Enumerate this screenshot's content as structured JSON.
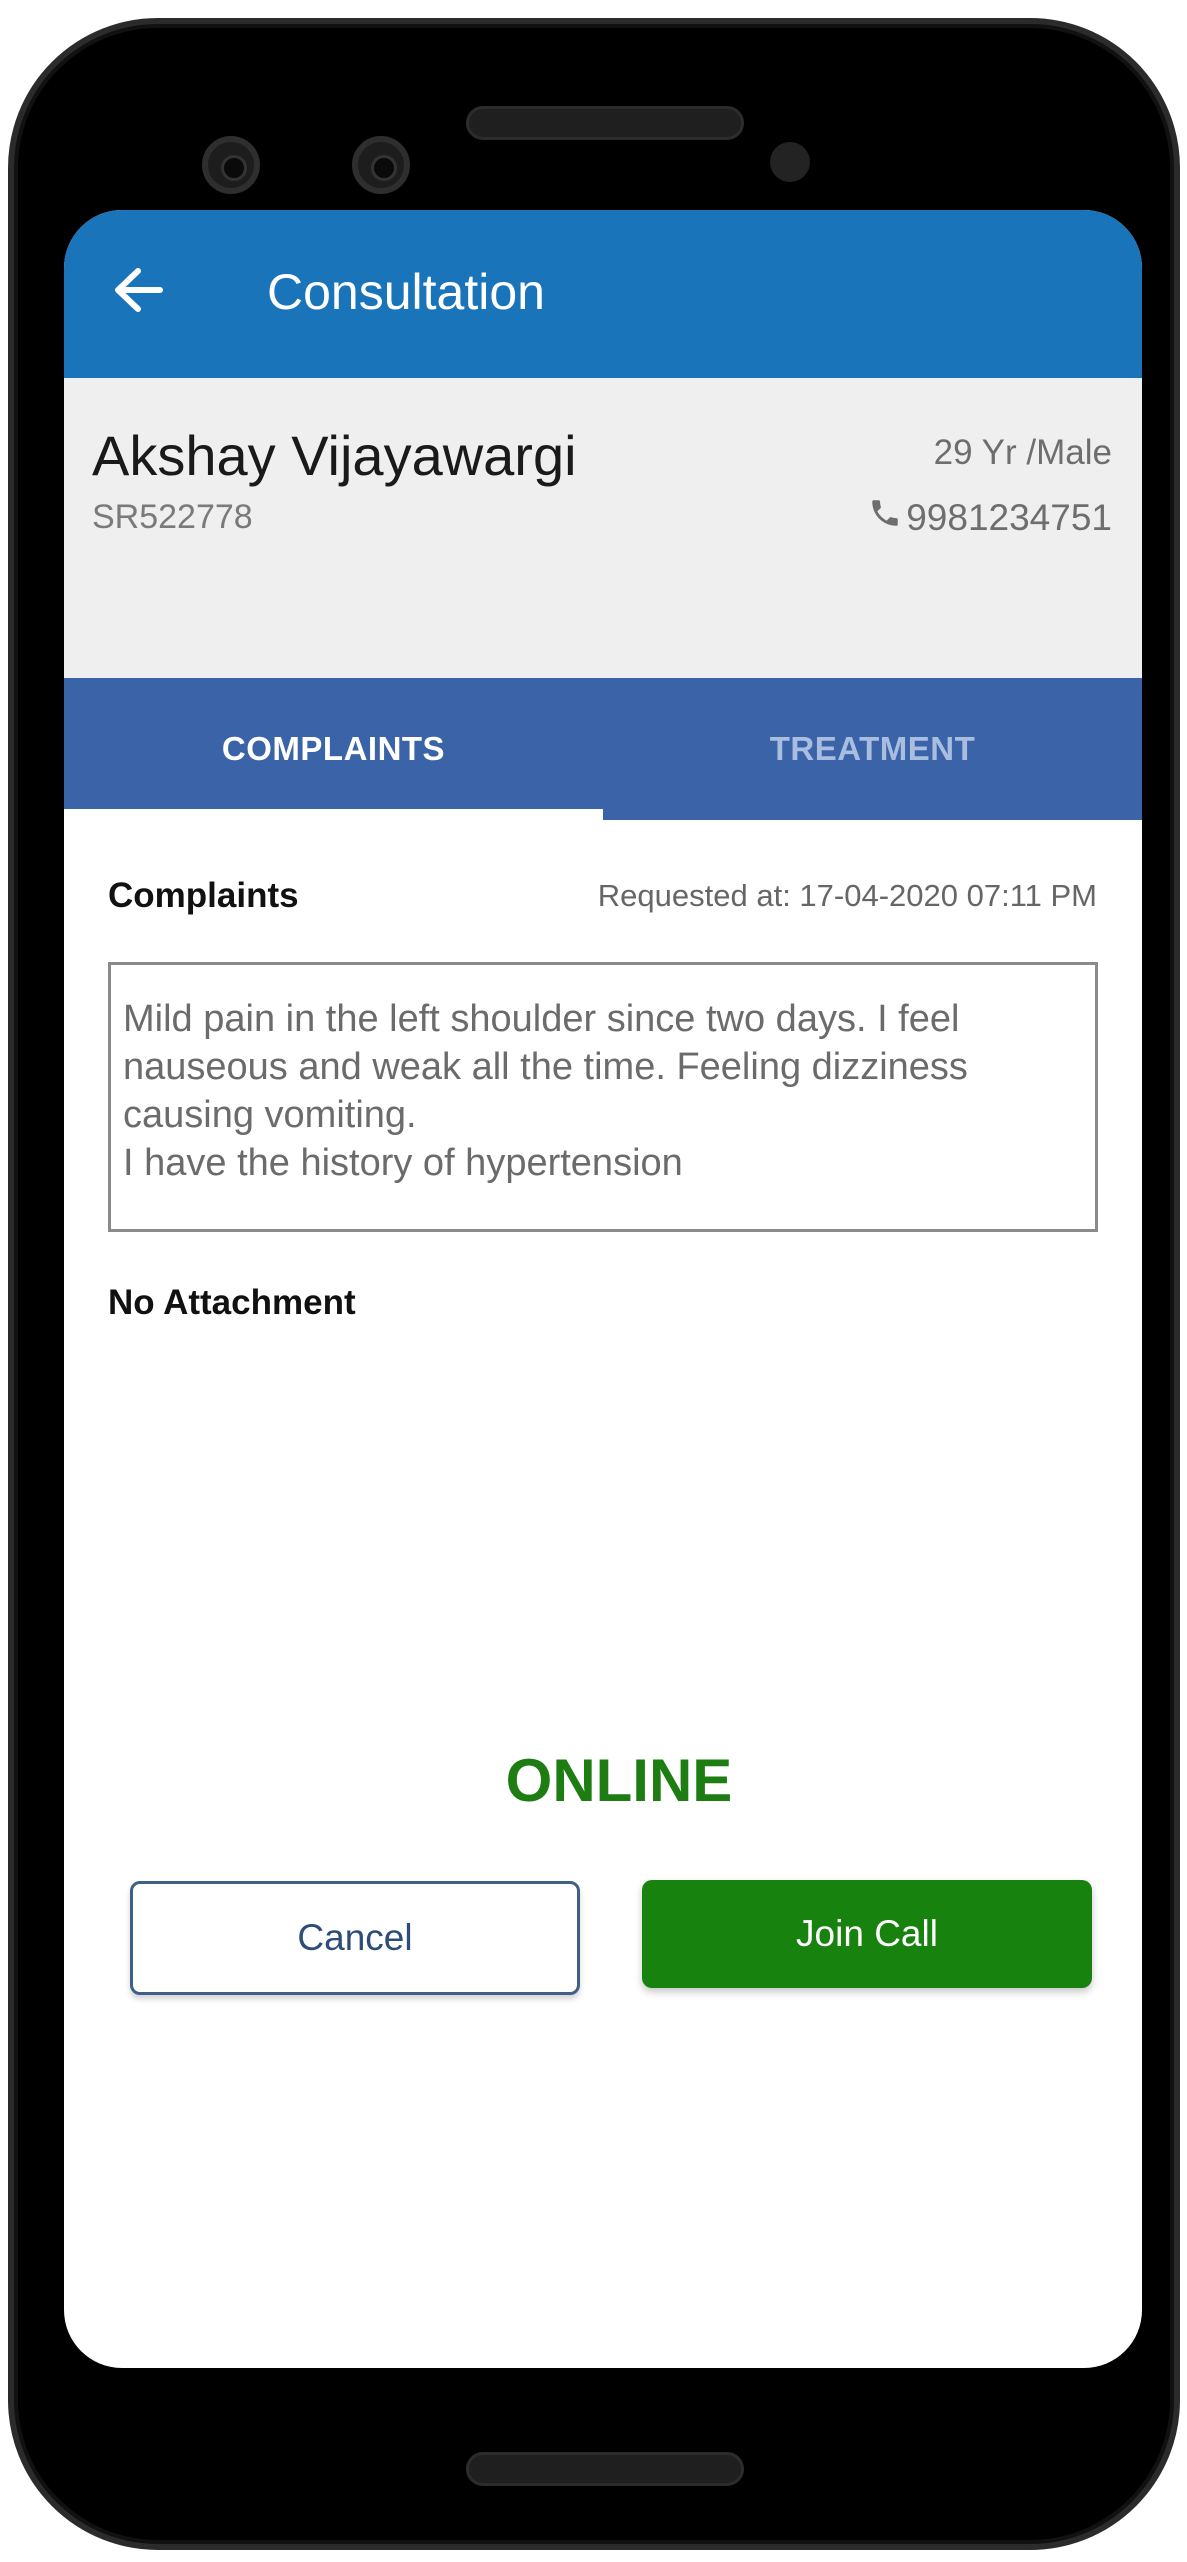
{
  "header": {
    "title": "Consultation",
    "back_icon": "arrow-left-icon"
  },
  "patient": {
    "name": "Akshay Vijayawargi",
    "id": "SR522778",
    "age_gender": "29 Yr /Male",
    "phone": "9981234751",
    "phone_icon": "phone-icon"
  },
  "tabs": [
    {
      "label": "COMPLAINTS",
      "active": true
    },
    {
      "label": "TREATMENT",
      "active": false
    }
  ],
  "complaints": {
    "label": "Complaints",
    "requested_at": "Requested at: 17-04-2020 07:11 PM",
    "text": "Mild pain in the left shoulder since two days. I feel nauseous and weak all the time. Feeling dizziness causing vomiting.\nI have the history of hypertension",
    "attachment_text": "No Attachment"
  },
  "consultation": {
    "status": "ONLINE",
    "cancel_label": "Cancel",
    "join_label": "Join Call"
  },
  "colors": {
    "appbar": "#1a74b9",
    "tabs": "#3b63a8",
    "status": "#1e7d12",
    "join_button": "#18820f"
  }
}
